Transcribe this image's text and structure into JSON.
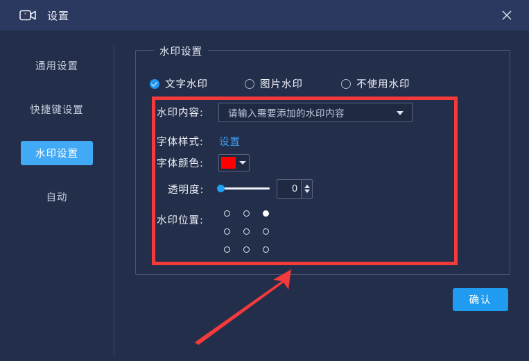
{
  "window": {
    "title": "设置",
    "app_icon": "video-camera-icon",
    "close_icon": "close-icon",
    "titlebar_color": "#2b3860",
    "body_color": "#232e4a"
  },
  "sidebar": {
    "items": [
      {
        "label": "通用设置",
        "active": false
      },
      {
        "label": "快捷键设置",
        "active": false
      },
      {
        "label": "水印设置",
        "active": true
      },
      {
        "label": "自动",
        "active": false
      }
    ],
    "active_color": "#41a9f5"
  },
  "main": {
    "group_title": "水印设置",
    "watermark_type": {
      "options": [
        {
          "label": "文字水印",
          "checked": true
        },
        {
          "label": "图片水印",
          "checked": false
        },
        {
          "label": "不使用水印",
          "checked": false
        }
      ],
      "checked_color": "#2196f3"
    },
    "fields": {
      "content_label": "水印内容:",
      "content_placeholder": "请输入需要添加的水印内容",
      "content_value": "",
      "font_style_label": "字体样式:",
      "font_style_link": "设置",
      "font_color_label": "字体颜色:",
      "font_color_value": "#ff0000",
      "opacity_label": "透明度:",
      "opacity_value": "0",
      "opacity_min": "0",
      "opacity_max": "100",
      "position_label": "水印位置:"
    },
    "position_grid": {
      "cells": [
        [
          "top-left",
          "top-center",
          "top-right"
        ],
        [
          "middle-left",
          "middle-center",
          "middle-right"
        ],
        [
          "bottom-left",
          "bottom-center",
          "bottom-right"
        ]
      ],
      "selected": "top-right"
    },
    "confirm_label": "确认",
    "confirm_color": "#1f9bf0"
  },
  "annotations": {
    "highlight_color": "#f43a3a",
    "rect_target": "watermark-settings-fields",
    "arrow_target": "watermark-settings-fields"
  }
}
